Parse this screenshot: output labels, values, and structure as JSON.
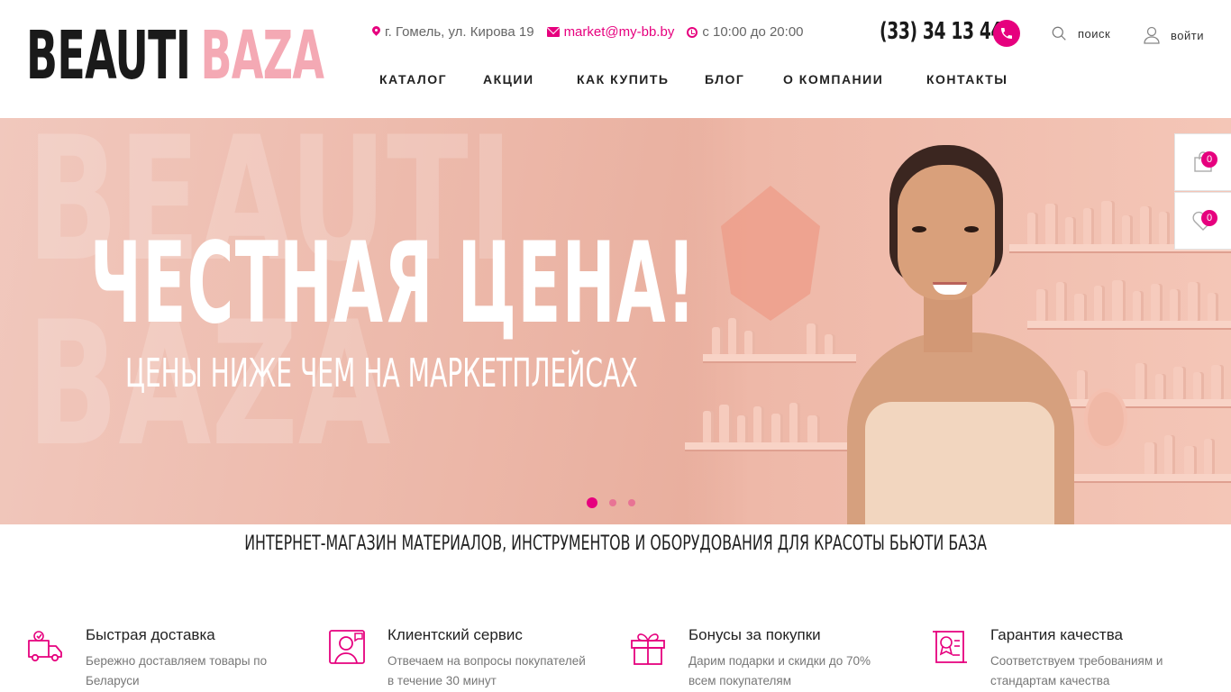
{
  "brand": {
    "logo_dark": "BEAUTI",
    "logo_pink": "BAZA"
  },
  "contacts": {
    "address": "г. Гомель, ул. Кирова 19",
    "email": "market@my-bb.by",
    "hours": "с 10:00 до 20:00",
    "phone": "(33) 34 13 444"
  },
  "header": {
    "search_label": "поиск",
    "login_label": "войти"
  },
  "nav": [
    "КАТАЛОГ",
    "АКЦИИ",
    "КАК КУПИТЬ",
    "БЛОГ",
    "О КОМПАНИИ",
    "КОНТАКТЫ"
  ],
  "hero": {
    "title": "ЧЕСТНАЯ ЦЕНА!",
    "subtitle": "ЦЕНЫ НИЖЕ ЧЕМ НА МАРКЕТПЛЕЙСАХ",
    "watermark_1": "BEAUTI",
    "watermark_2": "BAZA",
    "slides_total": 3,
    "active_slide": 1
  },
  "side": {
    "cart_count": "0",
    "favorites_count": "0"
  },
  "tagline": "ИНТЕРНЕТ-МАГАЗИН МАТЕРИАЛОВ, ИНСТРУМЕНТОВ И ОБОРУДОВАНИЯ ДЛЯ КРАСОТЫ БЬЮТИ БАЗА",
  "features": [
    {
      "icon": "delivery-truck-icon",
      "title": "Быстрая доставка",
      "desc": "Бережно доставляем товары по Беларуси"
    },
    {
      "icon": "customer-support-icon",
      "title": "Клиентский сервис",
      "desc": "Отвечаем на вопросы покупателей в течение 30 минут"
    },
    {
      "icon": "gift-icon",
      "title": "Бонусы за покупки",
      "desc": "Дарим подарки и скидки до 70% всем покупателям"
    },
    {
      "icon": "quality-certificate-icon",
      "title": "Гарантия качества",
      "desc": "Соответствуем требованиям и стандартам качества"
    }
  ],
  "colors": {
    "accent": "#e6007e",
    "logo_pink": "#f4a9b4",
    "hero_bg": "#ecb7a8"
  }
}
